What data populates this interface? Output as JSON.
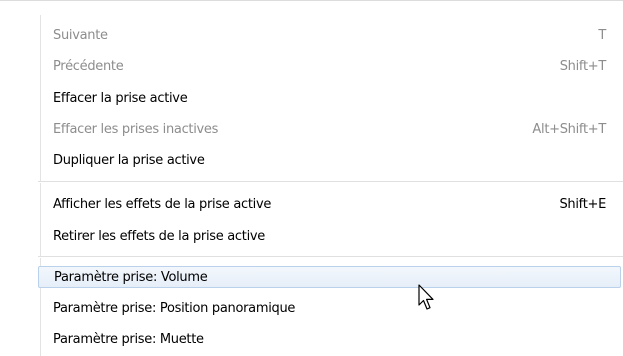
{
  "menu": {
    "group1": [
      {
        "label": "Suivante",
        "shortcut": "T",
        "disabled": true
      },
      {
        "label": "Précédente",
        "shortcut": "Shift+T",
        "disabled": true
      },
      {
        "label": "Effacer la prise active",
        "shortcut": "",
        "disabled": false
      },
      {
        "label": "Effacer les prises inactives",
        "shortcut": "Alt+Shift+T",
        "disabled": true
      },
      {
        "label": "Dupliquer la prise active",
        "shortcut": "",
        "disabled": false
      }
    ],
    "group2": [
      {
        "label": "Afficher les effets de la prise active",
        "shortcut": "Shift+E",
        "disabled": false
      },
      {
        "label": "Retirer les effets de la prise active",
        "shortcut": "",
        "disabled": false
      }
    ],
    "group3": [
      {
        "label": "Paramètre prise: Volume",
        "shortcut": "",
        "disabled": false,
        "hovered": true
      },
      {
        "label": "Paramètre prise: Position panoramique",
        "shortcut": "",
        "disabled": false
      },
      {
        "label": "Paramètre prise: Muette",
        "shortcut": "",
        "disabled": false
      }
    ]
  },
  "colors": {
    "disabled_text": "#8d8d8d",
    "hover_border": "#b9d1ea",
    "hover_fill": "#e6eef8"
  },
  "icons": {
    "cursor": "mouse-pointer-icon"
  }
}
